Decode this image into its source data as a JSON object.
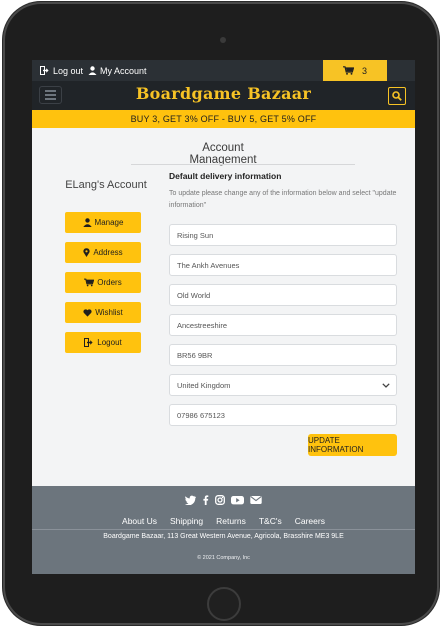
{
  "topbar": {
    "logout_label": "Log out",
    "account_label": "My Account",
    "cart_count": "3"
  },
  "navbar": {
    "brand": "Boardgame Bazaar"
  },
  "promo": {
    "text": "BUY 3, GET 3% OFF - BUY 5, GET 5% OFF"
  },
  "page": {
    "title": "Account Management"
  },
  "sidebar": {
    "title": "ELang's Account",
    "buttons": [
      {
        "label": "Manage",
        "icon": "user-icon"
      },
      {
        "label": "Address",
        "icon": "map-marker-icon"
      },
      {
        "label": "Orders",
        "icon": "cart-icon"
      },
      {
        "label": "Wishlist",
        "icon": "heart-icon"
      },
      {
        "label": "Logout",
        "icon": "sign-out-icon"
      }
    ]
  },
  "form": {
    "title": "Default delivery information",
    "help": "To update please change any of the information below and select \"update information\"",
    "fields": {
      "address1": "Rising Sun",
      "address2": "The Ankh Avenues",
      "town": "Old World",
      "county": "Ancestreeshire",
      "postcode": "BR56 9BR",
      "country": "United Kingdom",
      "phone": "07986 675123"
    },
    "submit_label": "UPDATE INFORMATION"
  },
  "footer": {
    "social_icons": [
      "twitter-icon",
      "facebook-icon",
      "instagram-icon",
      "youtube-icon",
      "envelope-icon"
    ],
    "links": [
      "About Us",
      "Shipping",
      "Returns",
      "T&C's",
      "Careers"
    ],
    "address": "Boardgame Bazaar, 113 Great Western Avenue, Agricola, Brasshire ME3 9LE",
    "copyright": "© 2021 Company, Inc"
  },
  "colors": {
    "accent": "#ffc20e",
    "nav_dark": "#202428",
    "topbar": "#2b3035",
    "footer": "#6c757d",
    "background": "#f3f4f5"
  }
}
